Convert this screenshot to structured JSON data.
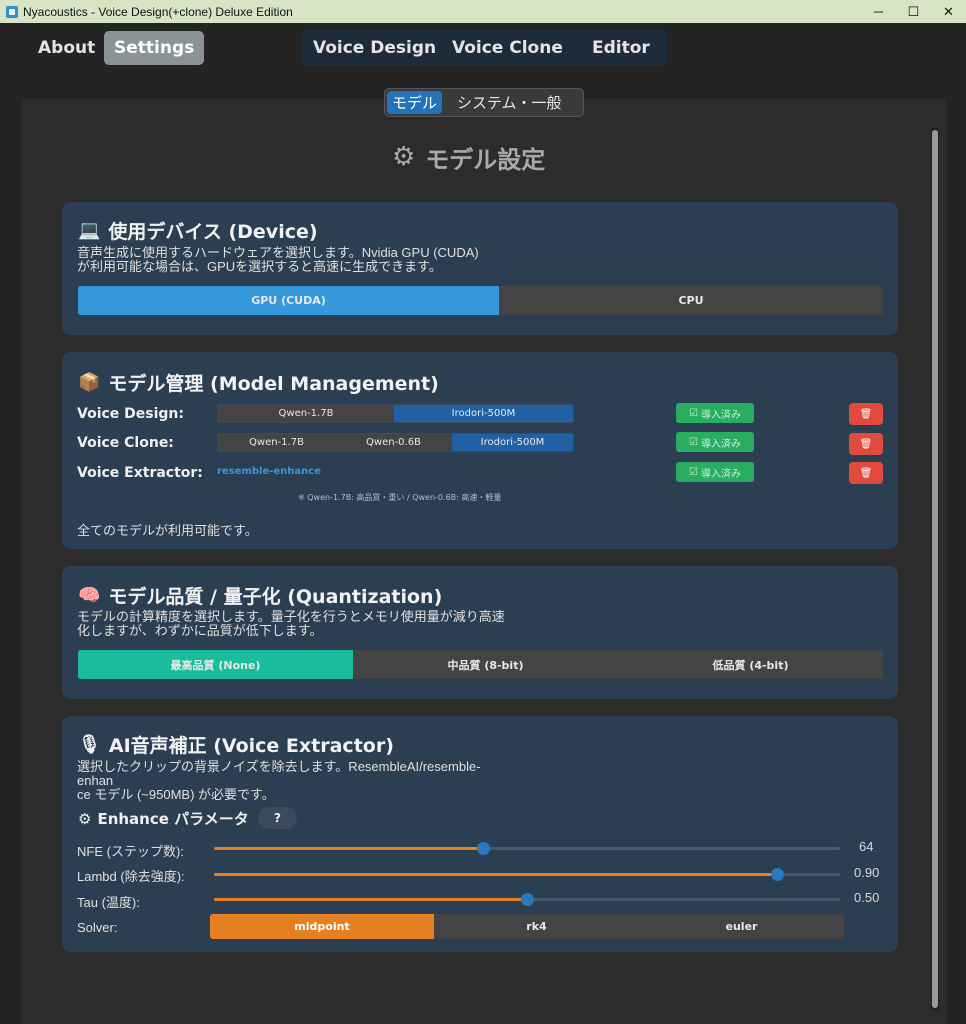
{
  "window": {
    "title": "Nyacoustics - Voice Design(+clone) Deluxe Edition",
    "controls": {
      "minimize": "─",
      "maximize": "☐",
      "close": "✕"
    }
  },
  "nav": {
    "left_tabs": [
      {
        "label": "About",
        "active": false
      },
      {
        "label": "Settings",
        "active": true
      }
    ],
    "center_tabs": [
      {
        "label": "Voice Design"
      },
      {
        "label": "Voice Clone"
      },
      {
        "label": "Editor"
      }
    ]
  },
  "subtabs": [
    {
      "label": "モデル",
      "active": true
    },
    {
      "label": "システム・一般",
      "active": false
    }
  ],
  "page_title": "モデル設定",
  "device": {
    "title": "使用デバイス (Device)",
    "desc_line1": "音声生成に使用するハードウェアを選択します。Nvidia GPU (CUDA)",
    "desc_line2": "が利用可能な場合は、GPUを選択すると高速に生成できます。",
    "options": [
      {
        "label": "GPU (CUDA)",
        "active": true
      },
      {
        "label": "CPU",
        "active": false
      }
    ]
  },
  "models": {
    "title": "モデル管理 (Model Management)",
    "rows": [
      {
        "label": "Voice Design:",
        "options": [
          "Qwen-1.7B",
          "Irodori-500M"
        ],
        "active_index": 1,
        "status": "導入済み"
      },
      {
        "label": "Voice Clone:",
        "options": [
          "Qwen-1.7B",
          "Qwen-0.6B",
          "Irodori-500M"
        ],
        "active_index": 2,
        "status": "導入済み"
      },
      {
        "label": "Voice Extractor:",
        "value": "resemble-enhance",
        "status": "導入済み"
      }
    ],
    "note": "※ Qwen-1.7B: 高品質・重い / Qwen-0.6B: 高速・軽量",
    "footer": "全てのモデルが利用可能です。"
  },
  "quantization": {
    "title": "モデル品質 / 量子化 (Quantization)",
    "desc_line1": "モデルの計算精度を選択します。量子化を行うとメモリ使用量が減り高速",
    "desc_line2": "化しますが、わずかに品質が低下します。",
    "options": [
      {
        "label": "最高品質 (None)",
        "active": true
      },
      {
        "label": "中品質 (8-bit)",
        "active": false
      },
      {
        "label": "低品質 (4-bit)",
        "active": false
      }
    ]
  },
  "extractor": {
    "title": "AI音声補正 (Voice Extractor)",
    "desc_line1": "選択したクリップの背景ノイズを除去します。ResembleAI/resemble-enhan",
    "desc_line2": "ce モデル (~950MB) が必要です。",
    "params_title": "Enhance パラメータ",
    "help_label": "?",
    "sliders": [
      {
        "label": "NFE (ステップ数):",
        "value": "64",
        "fraction": 0.43
      },
      {
        "label": "Lambd (除去強度):",
        "value": "0.90",
        "fraction": 0.9
      },
      {
        "label": "Tau (温度):",
        "value": "0.50",
        "fraction": 0.5
      }
    ],
    "solver_label": "Solver:",
    "solver_options": [
      {
        "label": "midpoint",
        "active": true
      },
      {
        "label": "rk4",
        "active": false
      },
      {
        "label": "euler",
        "active": false
      }
    ]
  },
  "colors": {
    "accent_blue": "#3498db",
    "accent_teal": "#1abc9c",
    "accent_orange": "#e67e22",
    "installed_green": "#27ae60",
    "delete_red": "#e14a3c"
  }
}
